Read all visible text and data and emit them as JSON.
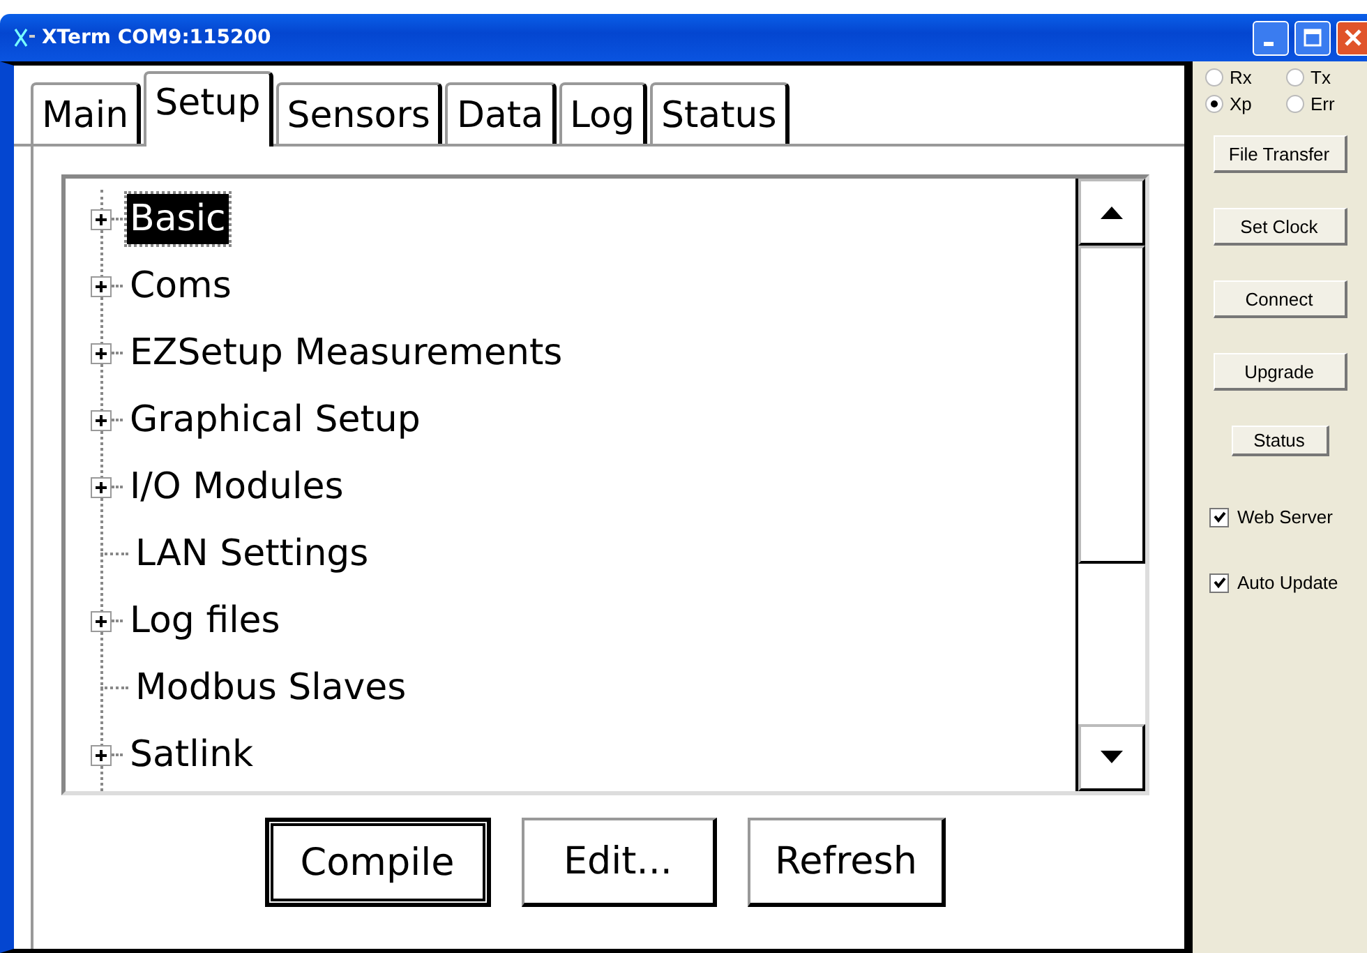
{
  "window": {
    "title": "XTerm COM9:115200"
  },
  "tabs": [
    {
      "label": "Main",
      "selected": false
    },
    {
      "label": "Setup",
      "selected": true
    },
    {
      "label": "Sensors",
      "selected": false
    },
    {
      "label": "Data",
      "selected": false
    },
    {
      "label": "Log",
      "selected": false
    },
    {
      "label": "Status",
      "selected": false
    }
  ],
  "tree": {
    "items": [
      {
        "label": "Basic",
        "expandable": true,
        "selected": true
      },
      {
        "label": "Coms",
        "expandable": true,
        "selected": false
      },
      {
        "label": "EZSetup Measurements",
        "expandable": true,
        "selected": false
      },
      {
        "label": "Graphical Setup",
        "expandable": true,
        "selected": false
      },
      {
        "label": "I/O Modules",
        "expandable": true,
        "selected": false
      },
      {
        "label": "LAN Settings",
        "expandable": false,
        "selected": false
      },
      {
        "label": "Log files",
        "expandable": true,
        "selected": false
      },
      {
        "label": "Modbus Slaves",
        "expandable": false,
        "selected": false
      },
      {
        "label": "Satlink",
        "expandable": true,
        "selected": false
      }
    ]
  },
  "bottom_buttons": [
    "Compile",
    "Edit...",
    "Refresh"
  ],
  "side_panel": {
    "radios": [
      {
        "label": "Rx",
        "selected": false
      },
      {
        "label": "Tx",
        "selected": false
      },
      {
        "label": "Xp",
        "selected": true
      },
      {
        "label": "Err",
        "selected": false
      }
    ],
    "buttons": [
      "File Transfer",
      "Set Clock",
      "Connect",
      "Upgrade",
      "Status"
    ],
    "checkboxes": [
      {
        "label": "Web Server",
        "checked": true
      },
      {
        "label": "Auto Update",
        "checked": true
      }
    ]
  }
}
